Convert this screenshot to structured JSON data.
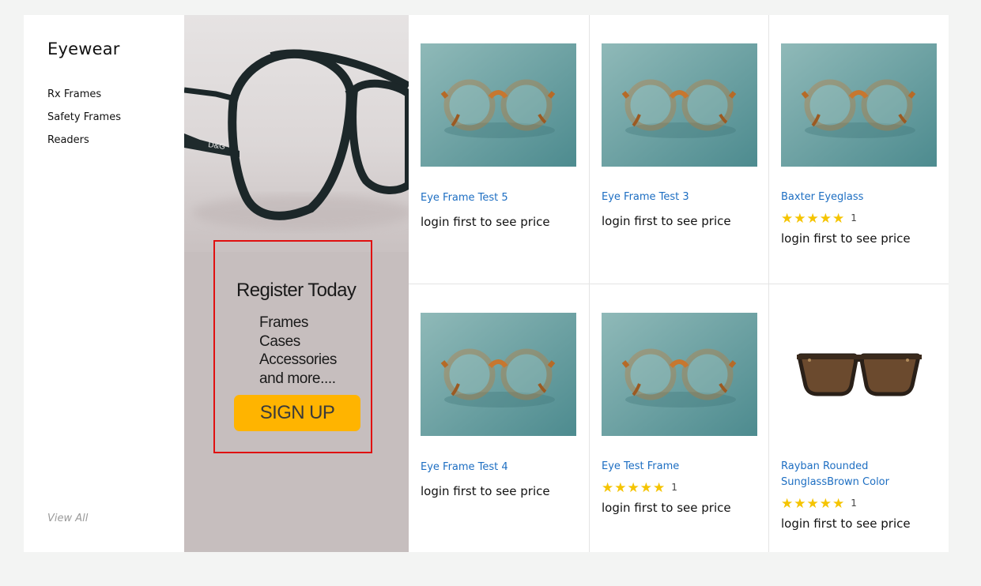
{
  "sidebar": {
    "title": "Eyewear",
    "items": [
      {
        "label": "Rx Frames"
      },
      {
        "label": "Safety Frames"
      },
      {
        "label": "Readers"
      }
    ],
    "view_all": "View All"
  },
  "banner": {
    "brand_mark": "D&G",
    "title": "Register Today",
    "items": [
      "Frames",
      "Cases",
      "Accessories",
      "and more...."
    ],
    "signup_label": "SIGN UP",
    "border_color": "#e01010",
    "button_color": "#ffb400"
  },
  "products": [
    {
      "name": "Eye Frame Test 5",
      "price_text": "login first to see price",
      "image": "wood-round-frames"
    },
    {
      "name": "Eye Frame Test 3",
      "price_text": "login first to see price",
      "image": "wood-round-frames"
    },
    {
      "name": "Baxter Eyeglass",
      "price_text": "login first to see price",
      "image": "wood-round-frames",
      "stars": "★★★★★",
      "rating": 5,
      "review_count": "1"
    },
    {
      "name": "Eye Frame Test 4",
      "price_text": "login first to see price",
      "image": "wood-round-frames"
    },
    {
      "name": "Eye Test Frame",
      "price_text": "login first to see price",
      "image": "wood-round-frames",
      "stars": "★★★★★",
      "rating": 5,
      "review_count": "1"
    },
    {
      "name": "Rayban Rounded SunglassBrown Color",
      "price_text": "login first to see price",
      "image": "tortoise-sunglasses",
      "stars": "★★★★★",
      "rating": 5,
      "review_count": "1"
    }
  ],
  "colors": {
    "link": "#1d6ec2",
    "star": "#f5c400"
  }
}
